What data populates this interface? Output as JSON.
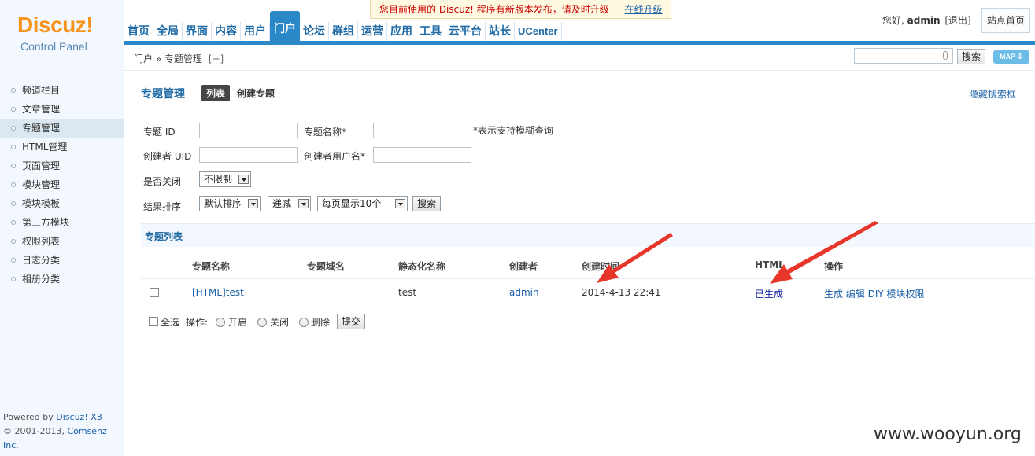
{
  "header": {
    "logo_title": "Discuz!",
    "logo_subtitle": "Control Panel",
    "notice_text": "您目前使用的 Discuz! 程序有新版本发布，请及时升级",
    "notice_link": "在线升级",
    "nav": [
      "首页",
      "全局",
      "界面",
      "内容",
      "用户",
      "门户",
      "论坛",
      "群组",
      "运营",
      "应用",
      "工具",
      "云平台",
      "站长",
      "UCenter"
    ],
    "nav_active": "门户",
    "greeting": "您好,",
    "username": "admin",
    "logout": "[退出]",
    "site_home": "站点首页"
  },
  "subbar": {
    "breadcrumb": "门户 » 专题管理",
    "breadcrumb_plus": "[+]",
    "search_button": "搜索",
    "map_button": "MAP ⇩"
  },
  "sidebar": {
    "items": [
      "频道栏目",
      "文章管理",
      "专题管理",
      "HTML管理",
      "页面管理",
      "模块管理",
      "模块模板",
      "第三方模块",
      "权限列表",
      "日志分类",
      "相册分类"
    ],
    "active": "专题管理",
    "footer_line1_prefix": "Powered by ",
    "footer_line1_brand": "Discuz! X3",
    "footer_line2_prefix": "© 2001-2013, ",
    "footer_line2_brand": "Comsenz Inc."
  },
  "main": {
    "title": "专题管理",
    "tab_list": "列表",
    "tab_create": "创建专题",
    "hide_search": "隐藏搜索框",
    "form": {
      "topic_id_label": "专题 ID",
      "topic_name_label": "专题名称*",
      "fuzzy_hint": "*表示支持模糊查询",
      "creator_uid_label": "创建者 UID",
      "creator_name_label": "创建者用户名*",
      "closed_label": "是否关闭",
      "closed_value": "不限制",
      "sort_label": "结果排序",
      "sort_value": "默认排序",
      "order_value": "递减",
      "perpage_value": "每页显示10个",
      "search_button": "搜索"
    },
    "list_title": "专题列表",
    "columns": [
      "专题名称",
      "专题域名",
      "静态化名称",
      "创建者",
      "创建时间",
      "HTML",
      "操作"
    ],
    "rows": [
      {
        "name": "[HTML]test",
        "domain": "",
        "static_name": "test",
        "creator": "admin",
        "created": "2014-4-13 22:41",
        "html": "已生成",
        "actions": "生成 编辑 DIY 模块权限"
      }
    ],
    "bottom": {
      "select_all": "全选",
      "ops_label": "操作:",
      "op_open": "开启",
      "op_close": "关闭",
      "op_delete": "删除",
      "submit": "提交"
    }
  },
  "watermark": "www.wooyun.org",
  "colors": {
    "accent": "#2a87c8",
    "arrow": "#e8362a",
    "logo": "#f7941d"
  }
}
